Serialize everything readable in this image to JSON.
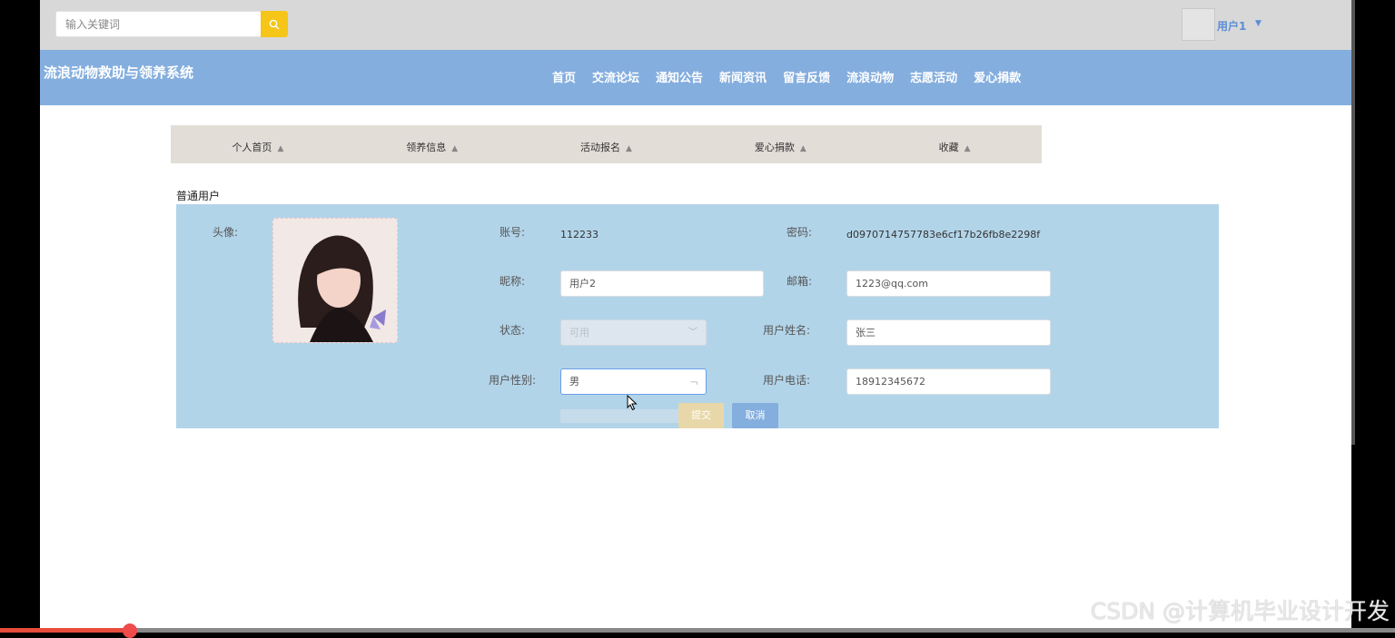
{
  "header": {
    "search_placeholder": "输入关键词",
    "user_name": "用户1",
    "site_title": "流浪动物救助与领养系统",
    "nav": [
      "首页",
      "交流论坛",
      "通知公告",
      "新闻资讯",
      "留言反馈",
      "流浪动物",
      "志愿活动",
      "爱心捐款"
    ]
  },
  "sub_nav": [
    "个人首页",
    "领养信息",
    "活动报名",
    "爱心捐款",
    "收藏"
  ],
  "section_label": "普通用户",
  "form": {
    "avatar_label": "头像:",
    "account_label": "账号:",
    "account_value": "112233",
    "password_label": "密码:",
    "password_value": "d0970714757783e6cf17b26fb8e2298f",
    "nickname_label": "昵称:",
    "nickname_value": "用户2",
    "email_label": "邮箱:",
    "email_value": "1223@qq.com",
    "status_label": "状态:",
    "status_value": "可用",
    "realname_label": "用户姓名:",
    "realname_value": "张三",
    "gender_label": "用户性别:",
    "gender_value": "男",
    "phone_label": "用户电话:",
    "phone_value": "18912345672",
    "submit_label": "提交",
    "cancel_label": "取消"
  },
  "watermark": "CSDN @计算机毕业设计开发",
  "colors": {
    "nav_bg": "#84aede",
    "panel_bg": "#b2d4e9",
    "search_btn": "#f5c518"
  },
  "video_progress": 0.09
}
